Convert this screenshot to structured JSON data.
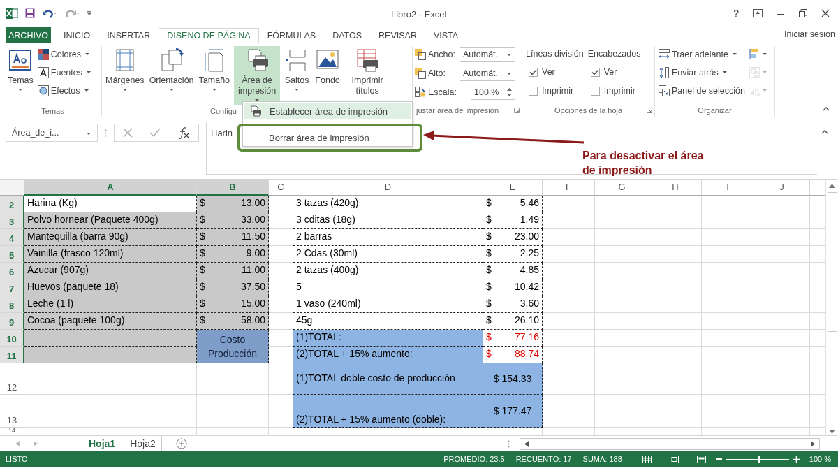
{
  "window": {
    "title": "Libro2 - Excel",
    "help": "?"
  },
  "tabs": [
    {
      "label": "ARCHIVO",
      "kind": "file",
      "selected": false
    },
    {
      "label": "INICIO",
      "kind": "tab",
      "selected": false
    },
    {
      "label": "INSERTAR",
      "kind": "tab",
      "selected": false
    },
    {
      "label": "DISEÑO DE PÁGINA",
      "kind": "tab",
      "selected": true
    },
    {
      "label": "FÓRMULAS",
      "kind": "tab",
      "selected": false
    },
    {
      "label": "DATOS",
      "kind": "tab",
      "selected": false
    },
    {
      "label": "REVISAR",
      "kind": "tab",
      "selected": false
    },
    {
      "label": "VISTA",
      "kind": "tab",
      "selected": false
    }
  ],
  "account": "Iniciar sesión",
  "ribbon": {
    "groups": [
      {
        "label": "Temas",
        "launcher": false,
        "columns": [
          [
            {
              "kind": "large",
              "label": "Temas",
              "dropdown": true,
              "pressed": false
            }
          ],
          [
            {
              "kind": "small",
              "label": "Colores",
              "dropdown": true
            },
            {
              "kind": "small",
              "label": "Fuentes",
              "dropdown": true
            },
            {
              "kind": "small",
              "label": "Efectos",
              "dropdown": true
            }
          ]
        ]
      },
      {
        "label": "Configu",
        "launcher": false,
        "columns": [
          [
            {
              "kind": "large",
              "label": "Márgenes",
              "dropdown": true,
              "pressed": false
            }
          ],
          [
            {
              "kind": "large",
              "label": "Orientación",
              "dropdown": true,
              "pressed": false
            }
          ],
          [
            {
              "kind": "large",
              "label": "Tamaño",
              "dropdown": true,
              "pressed": false
            }
          ],
          [
            {
              "kind": "large",
              "label": "Área de impresión",
              "dropdown": true,
              "pressed": true
            }
          ],
          [
            {
              "kind": "large",
              "label": "Saltos",
              "dropdown": true,
              "pressed": false
            }
          ],
          [
            {
              "kind": "large",
              "label": "Fondo",
              "dropdown": false,
              "pressed": false
            }
          ],
          [
            {
              "kind": "large",
              "label": "Imprimir títulos",
              "dropdown": false,
              "pressed": false
            }
          ]
        ]
      },
      {
        "label": "justar área de impresión",
        "launcher": true,
        "columns": [
          [
            {
              "kind": "dropdown_field",
              "label": "Ancho:",
              "value": "Automát."
            },
            {
              "kind": "dropdown_field",
              "label": "Alto:",
              "value": "Automát."
            },
            {
              "kind": "spinner_field",
              "label": "Escala:",
              "value": "100 %"
            }
          ]
        ]
      },
      {
        "label": "Opciones de la hoja",
        "launcher": true,
        "columns": [
          [
            {
              "kind": "heading",
              "label": "Líneas división"
            },
            {
              "kind": "check",
              "label": "Ver",
              "checked": true
            },
            {
              "kind": "check",
              "label": "Imprimir",
              "checked": false
            }
          ],
          [
            {
              "kind": "heading",
              "label": "Encabezados"
            },
            {
              "kind": "check",
              "label": "Ver",
              "checked": true
            },
            {
              "kind": "check",
              "label": "Imprimir",
              "checked": false
            }
          ]
        ]
      },
      {
        "label": "Organizar",
        "launcher": false,
        "columns": [
          [
            {
              "kind": "small",
              "label": "Traer adelante",
              "dropdown": true
            },
            {
              "kind": "small",
              "label": "Enviar atrás",
              "dropdown": true
            },
            {
              "kind": "small",
              "label": "Panel de selección",
              "dropdown": false
            }
          ],
          [
            {
              "kind": "icon_only",
              "disabled": false
            },
            {
              "kind": "icon_only",
              "disabled": true
            },
            {
              "kind": "icon_only",
              "disabled": true
            }
          ]
        ]
      }
    ]
  },
  "menu": {
    "items": [
      {
        "label": "Establecer área de impresión",
        "highlighted": true,
        "framed": false
      },
      {
        "label": "Borrar área de impresión",
        "highlighted": false,
        "framed": true
      }
    ]
  },
  "callout": {
    "text": "Para desactivar el área de impresión"
  },
  "formula_bar": {
    "name_box": "Área_de_i...",
    "formula": "Harin"
  },
  "sheet": {
    "columns": [
      {
        "label": "A",
        "selected": true
      },
      {
        "label": "B",
        "selected": true
      },
      {
        "label": "C",
        "selected": false
      },
      {
        "label": "D",
        "selected": false
      },
      {
        "label": "E",
        "selected": false
      },
      {
        "label": "F",
        "selected": false
      },
      {
        "label": "G",
        "selected": false
      },
      {
        "label": "H",
        "selected": false
      },
      {
        "label": "I",
        "selected": false
      },
      {
        "label": "J",
        "selected": false
      }
    ],
    "rows": [
      {
        "label": "2",
        "selected": true,
        "a": {
          "kind": "text",
          "text": "Harina (Kg)"
        },
        "b": {
          "kind": "money",
          "currency": "$",
          "amount": "13.00",
          "color": "#c9c9c9"
        },
        "d": {
          "kind": "text",
          "text": "3 tazas (420g)"
        },
        "e": {
          "kind": "money",
          "currency": "$",
          "amount": "5.46"
        }
      },
      {
        "label": "3",
        "selected": true,
        "a": {
          "kind": "text",
          "text": "Polvo hornear (Paquete 400g)",
          "color": "#c9c9c9"
        },
        "b": {
          "kind": "money",
          "currency": "$",
          "amount": "33.00",
          "color": "#c9c9c9"
        },
        "d": {
          "kind": "text",
          "text": "3 cditas (18g)"
        },
        "e": {
          "kind": "money",
          "currency": "$",
          "amount": "1.49"
        }
      },
      {
        "label": "4",
        "selected": true,
        "a": {
          "kind": "text",
          "text": "Mantequilla (barra 90g)",
          "color": "#c9c9c9"
        },
        "b": {
          "kind": "money",
          "currency": "$",
          "amount": "11.50",
          "color": "#c9c9c9"
        },
        "d": {
          "kind": "text",
          "text": "2 barras"
        },
        "e": {
          "kind": "money",
          "currency": "$",
          "amount": "23.00"
        }
      },
      {
        "label": "5",
        "selected": true,
        "a": {
          "kind": "text",
          "text": "Vainilla (frasco 120ml)",
          "color": "#c9c9c9"
        },
        "b": {
          "kind": "money",
          "currency": "$",
          "amount": "9.00",
          "color": "#c9c9c9"
        },
        "d": {
          "kind": "text",
          "text": "2 Cdas (30ml)"
        },
        "e": {
          "kind": "money",
          "currency": "$",
          "amount": "2.25"
        }
      },
      {
        "label": "6",
        "selected": true,
        "a": {
          "kind": "text",
          "text": "Azucar (907g)",
          "color": "#c9c9c9"
        },
        "b": {
          "kind": "money",
          "currency": "$",
          "amount": "11.00",
          "color": "#c9c9c9"
        },
        "d": {
          "kind": "text",
          "text": "2 tazas (400g)"
        },
        "e": {
          "kind": "money",
          "currency": "$",
          "amount": "4.85"
        }
      },
      {
        "label": "7",
        "selected": true,
        "a": {
          "kind": "text",
          "text": "Huevos (paquete 18)",
          "color": "#c9c9c9"
        },
        "b": {
          "kind": "money",
          "currency": "$",
          "amount": "37.50",
          "color": "#c9c9c9"
        },
        "d": {
          "kind": "text",
          "text": "5"
        },
        "e": {
          "kind": "money",
          "currency": "$",
          "amount": "10.42"
        }
      },
      {
        "label": "8",
        "selected": true,
        "a": {
          "kind": "text",
          "text": "Leche (1 l)",
          "color": "#c9c9c9"
        },
        "b": {
          "kind": "money",
          "currency": "$",
          "amount": "15.00",
          "color": "#c9c9c9"
        },
        "d": {
          "kind": "text",
          "text": "1 vaso (240ml)"
        },
        "e": {
          "kind": "money",
          "currency": "$",
          "amount": "3.60"
        }
      },
      {
        "label": "9",
        "selected": true,
        "a": {
          "kind": "text",
          "text": "Cocoa (paquete 100g)",
          "color": "#c9c9c9"
        },
        "b": {
          "kind": "money",
          "currency": "$",
          "amount": "58.00",
          "color": "#c9c9c9"
        },
        "d": {
          "kind": "text",
          "text": "45g"
        },
        "e": {
          "kind": "money",
          "currency": "$",
          "amount": "26.10"
        }
      },
      {
        "label": "10",
        "selected": true,
        "a": {
          "kind": "empty",
          "color": "#c9c9c9"
        },
        "b": {
          "kind": "centered",
          "text": "Costo Producción",
          "color": "#7e9dc9",
          "merged_down": true
        },
        "d": {
          "kind": "text",
          "text": "(1)TOTAL:",
          "color": "#8db4e2"
        },
        "e": {
          "kind": "money",
          "currency": "$",
          "amount": "77.16",
          "red": true
        }
      },
      {
        "label": "11",
        "selected": true,
        "a": {
          "kind": "empty",
          "color": "#c9c9c9"
        },
        "d": {
          "kind": "text",
          "text": "(2)TOTAL + 15% aumento:",
          "color": "#8db4e2"
        },
        "e": {
          "kind": "money",
          "currency": "$",
          "amount": "88.74",
          "red": true
        }
      },
      {
        "label": "12",
        "selected": false,
        "d": {
          "kind": "justified",
          "text": "(1)TOTAL doble costo de producción",
          "color": "#8db4e2"
        },
        "e": {
          "kind": "centered",
          "text": "$ 154.33",
          "color": "#8db4e2"
        }
      },
      {
        "label": "13",
        "selected": false,
        "d": {
          "kind": "text",
          "text": "(2)TOTAL + 15% aumento (doble):",
          "color": "#8db4e2",
          "bottom_aligned": true
        },
        "e": {
          "kind": "centered",
          "text": "$ 177.47",
          "color": "#8db4e2"
        }
      },
      {
        "label": "14",
        "selected": false
      }
    ]
  },
  "sheet_tabs": [
    {
      "label": "Hoja1",
      "selected": true
    },
    {
      "label": "Hoja2",
      "selected": false
    }
  ],
  "status_bar": {
    "mode": "LISTO",
    "stats": [
      "PROMEDIO: 23.5",
      "RECUENTO: 17",
      "SUMA: 188"
    ],
    "zoom": {
      "level": 0.52,
      "label": "100 %"
    }
  }
}
